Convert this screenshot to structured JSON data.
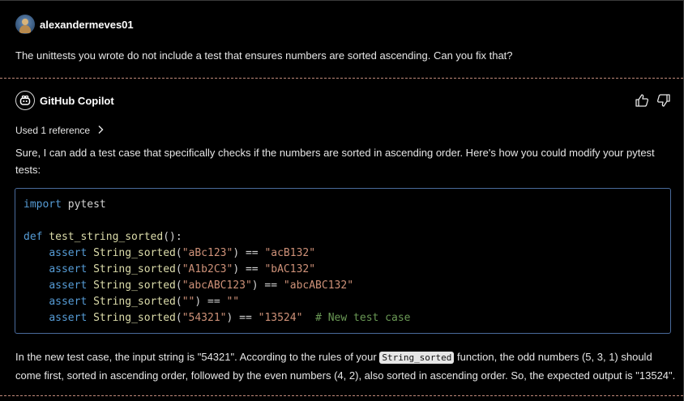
{
  "user": {
    "name": "alexandermeves01",
    "message": "The unittests you wrote do not include a test that ensures numbers are sorted ascending. Can you fix that?"
  },
  "assistant": {
    "name": "GitHub Copilot",
    "references_label": "Used 1 reference",
    "intro": "Sure, I can add a test case that specifically checks if the numbers are sorted in ascending order. Here's how you could modify your pytest tests:",
    "code": {
      "import_kw": "import",
      "import_mod": " pytest",
      "def_kw": "def",
      "func_name": " test_string_sorted",
      "func_sig": "():",
      "assert_kw": "assert",
      "call_name": " String_sorted",
      "lines": [
        {
          "arg": "\"aBc123\"",
          "expected": "\"acB132\"",
          "comment": ""
        },
        {
          "arg": "\"A1b2C3\"",
          "expected": "\"bAC132\"",
          "comment": ""
        },
        {
          "arg": "\"abcABC123\"",
          "expected": "\"abcABC132\"",
          "comment": ""
        },
        {
          "arg": "\"\"",
          "expected": "\"\"",
          "comment": ""
        },
        {
          "arg": "\"54321\"",
          "expected": "\"13524\"",
          "comment": "# New test case"
        }
      ],
      "eq": " == "
    },
    "outro_before": "In the new test case, the input string is \"54321\". According to the rules of your ",
    "outro_code": "String_sorted",
    "outro_after": " function, the odd numbers (5, 3, 1) should come first, sorted in ascending order, followed by the even numbers (4, 2), also sorted in ascending order. So, the expected output is \"13524\"."
  },
  "icons": {
    "user_avatar": "user-avatar",
    "bot_avatar": "copilot-icon",
    "thumbs_up": "thumbs-up-icon",
    "thumbs_down": "thumbs-down-icon",
    "chevron": "chevron-right-icon"
  },
  "colors": {
    "background": "#000000",
    "text": "#e6e6e6",
    "code_border": "#4a6b9c",
    "keyword": "#569cd6",
    "function": "#dcdcaa",
    "string": "#ce9178",
    "comment": "#6a9955",
    "divider": "#c08a7a"
  }
}
